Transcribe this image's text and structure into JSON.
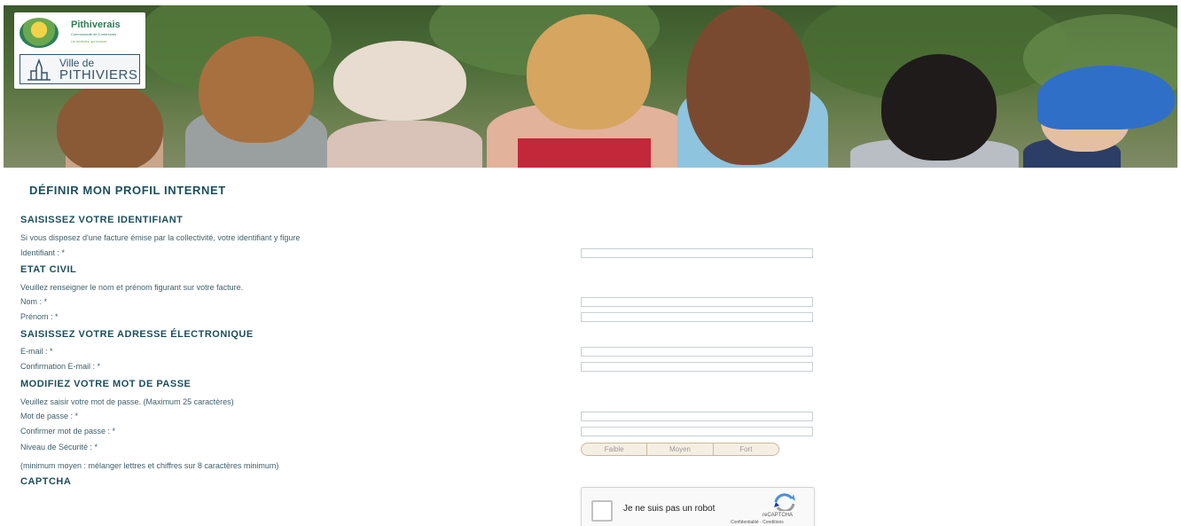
{
  "header": {
    "logo_name": "Pithiverais",
    "logo_subtitle": "Communauté de Communes",
    "logo_tagline": "Un territoire qui innove",
    "city_prefix": "Ville de",
    "city_name": "PITHIVIERS"
  },
  "page_title": "DÉFINIR MON PROFIL INTERNET",
  "sections": {
    "identifiant": {
      "title": "SAISISSEZ VOTRE IDENTIFIANT",
      "help": "Si vous disposez d'une facture émise par la collectivité, votre identifiant y figure",
      "label": "Identifiant : *"
    },
    "etat_civil": {
      "title": "ETAT CIVIL",
      "help": "Veuillez renseigner le nom et prénom figurant sur votre facture.",
      "nom_label": "Nom : *",
      "prenom_label": "Prénom : *"
    },
    "email": {
      "title": "SAISISSEZ VOTRE ADRESSE ÉLECTRONIQUE",
      "email_label": "E-mail : *",
      "confirm_label": "Confirmation E-mail : *"
    },
    "password": {
      "title": "MODIFIEZ VOTRE MOT DE PASSE",
      "help": "Veuillez saisir votre mot de passe. (Maximum 25 caractères)",
      "password_label": "Mot de passe : *",
      "confirm_label": "Confirmer mot de passe : *",
      "security_label": "Niveau de Sécurité : *",
      "strength_levels": [
        "Faible",
        "Moyen",
        "Fort"
      ],
      "hint": "(minimum moyen : mélanger lettres et chiffres sur 8 caractères minimum)"
    },
    "captcha": {
      "title": "CAPTCHA",
      "checkbox_label": "Je ne suis pas un robot",
      "brand": "reCAPTCHA",
      "links": "Confidentialité - Conditions"
    }
  },
  "colors": {
    "heading": "#1d4e5c",
    "text": "#3f5f6b",
    "input_border": "#c9cfd3"
  }
}
